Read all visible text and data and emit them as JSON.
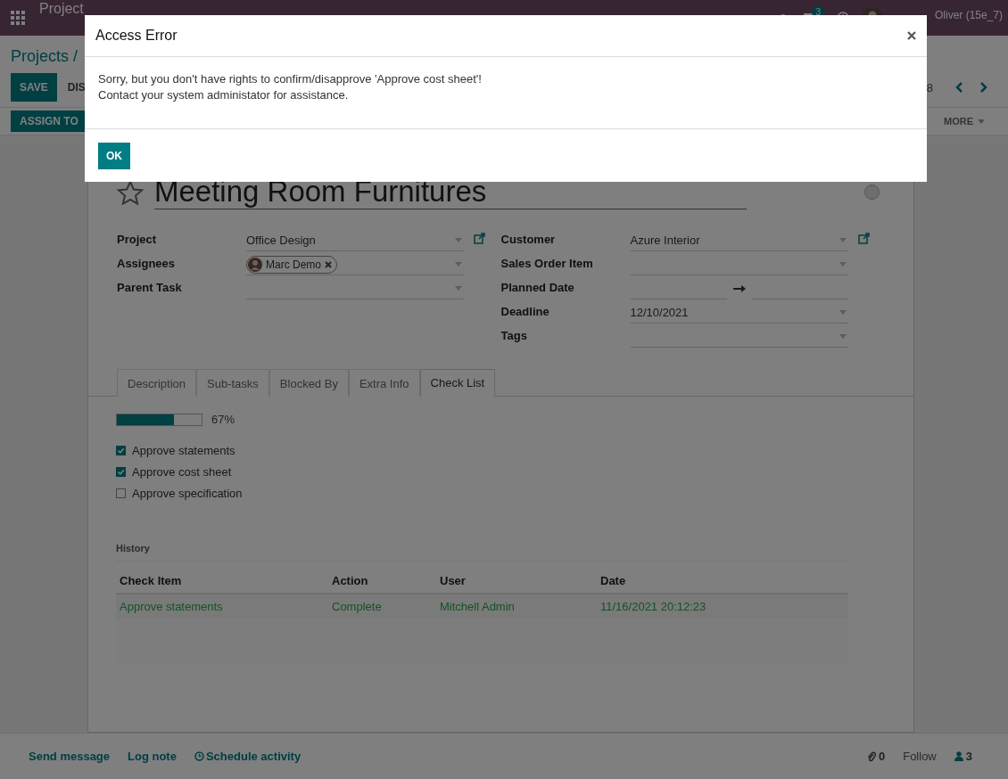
{
  "navbar": {
    "app": "Project",
    "messages_badge": "3",
    "user": "Oliver (15e_7)"
  },
  "breadcrumb": "Projects /",
  "actions": {
    "save": "SAVE",
    "discard": "DIS"
  },
  "pager": "8",
  "status_actions": {
    "assign": "ASSIGN TO",
    "more": "MORE"
  },
  "task": {
    "title": "Meeting Room Furnitures",
    "starred": false
  },
  "fields_left": [
    {
      "label": "Project",
      "kind": "select",
      "value": "Office Design",
      "link": true
    },
    {
      "label": "Assignees",
      "kind": "tags",
      "tags": [
        "Marc Demo"
      ]
    },
    {
      "label": "Parent Task",
      "kind": "select"
    }
  ],
  "fields_right": [
    {
      "label": "Customer",
      "kind": "select",
      "value": "Azure Interior",
      "link": true
    },
    {
      "label": "Sales Order Item",
      "kind": "select"
    },
    {
      "label": "Planned Date",
      "kind": "daterange"
    },
    {
      "label": "Deadline",
      "kind": "select",
      "value": "12/10/2021"
    },
    {
      "label": "Tags",
      "kind": "select"
    }
  ],
  "tabs": [
    {
      "label": "Description",
      "selected": false
    },
    {
      "label": "Sub-tasks",
      "selected": false
    },
    {
      "label": "Blocked By",
      "selected": false
    },
    {
      "label": "Extra Info",
      "selected": false
    },
    {
      "label": "Check List",
      "selected": true
    }
  ],
  "progress": {
    "level": 0.67,
    "reading": "67%"
  },
  "checklist": [
    {
      "label": "Approve statements",
      "checked": true
    },
    {
      "label": "Approve cost sheet",
      "checked": true
    },
    {
      "label": "Approve specification",
      "checked": false
    }
  ],
  "history": {
    "title": "History",
    "columns": [
      "Check Item",
      "Action",
      "User",
      "Date"
    ],
    "rows": [
      [
        "Approve statements",
        "Complete",
        "Mitchell Admin",
        "11/16/2021 20:12:23"
      ]
    ]
  },
  "chatter": {
    "send_message": "Send message",
    "log_note": "Log note",
    "schedule_activity": "Schedule activity",
    "attachments": "0",
    "follow": "Follow",
    "followers": "3"
  },
  "dialog": {
    "title": "Access Error",
    "lines": [
      "Sorry, but you don't have rights to confirm/disapprove 'Approve cost sheet'!",
      "Contact your system administator for assistance."
    ],
    "ok": "OK"
  }
}
